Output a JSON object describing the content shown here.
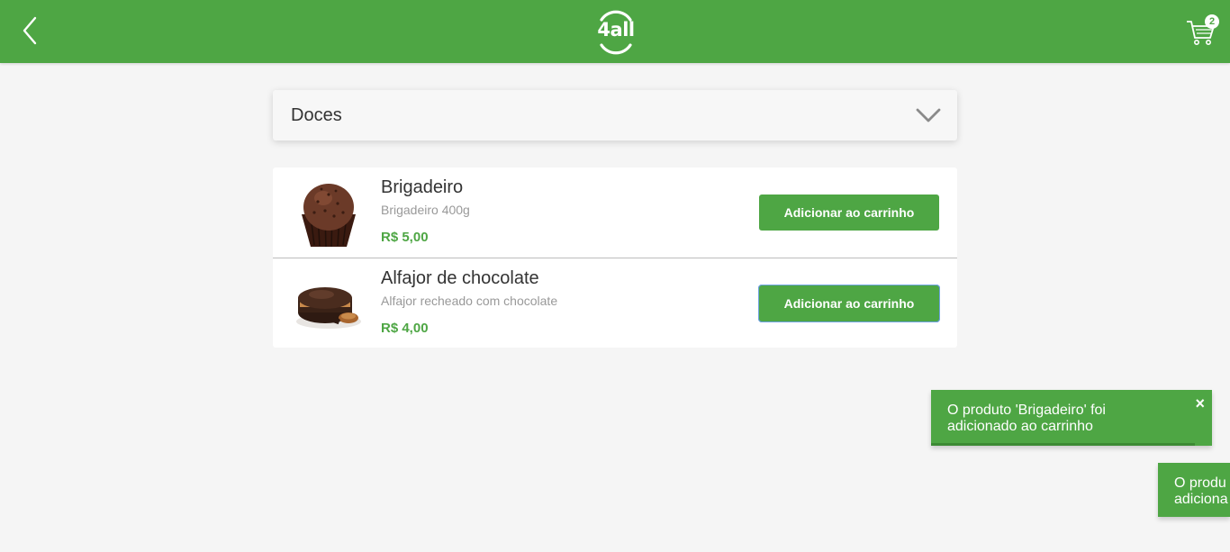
{
  "header": {
    "logo_text": "4all",
    "cart_count": "2",
    "brand_color": "#4ea644",
    "back_icon": "chevron-left-icon",
    "cart_icon": "shopping-cart-icon"
  },
  "category": {
    "label": "Doces",
    "chevron_icon": "chevron-down-icon"
  },
  "products": [
    {
      "name": "Brigadeiro",
      "description": "Brigadeiro 400g",
      "price": "R$ 5,00",
      "button_label": "Adicionar ao carrinho",
      "image_icon": "brigadeiro-image"
    },
    {
      "name": "Alfajor de chocolate",
      "description": "Alfajor recheado com chocolate",
      "price": "R$ 4,00",
      "button_label": "Adicionar ao carrinho",
      "image_icon": "alfajor-image"
    }
  ],
  "toasts": [
    {
      "line1": "O produto 'Brigadeiro' foi",
      "line2": "adicionado ao carrinho",
      "close_label": "×",
      "remaining_fraction": 0.94
    },
    {
      "line1": "O produ",
      "line2": "adiciona"
    }
  ]
}
